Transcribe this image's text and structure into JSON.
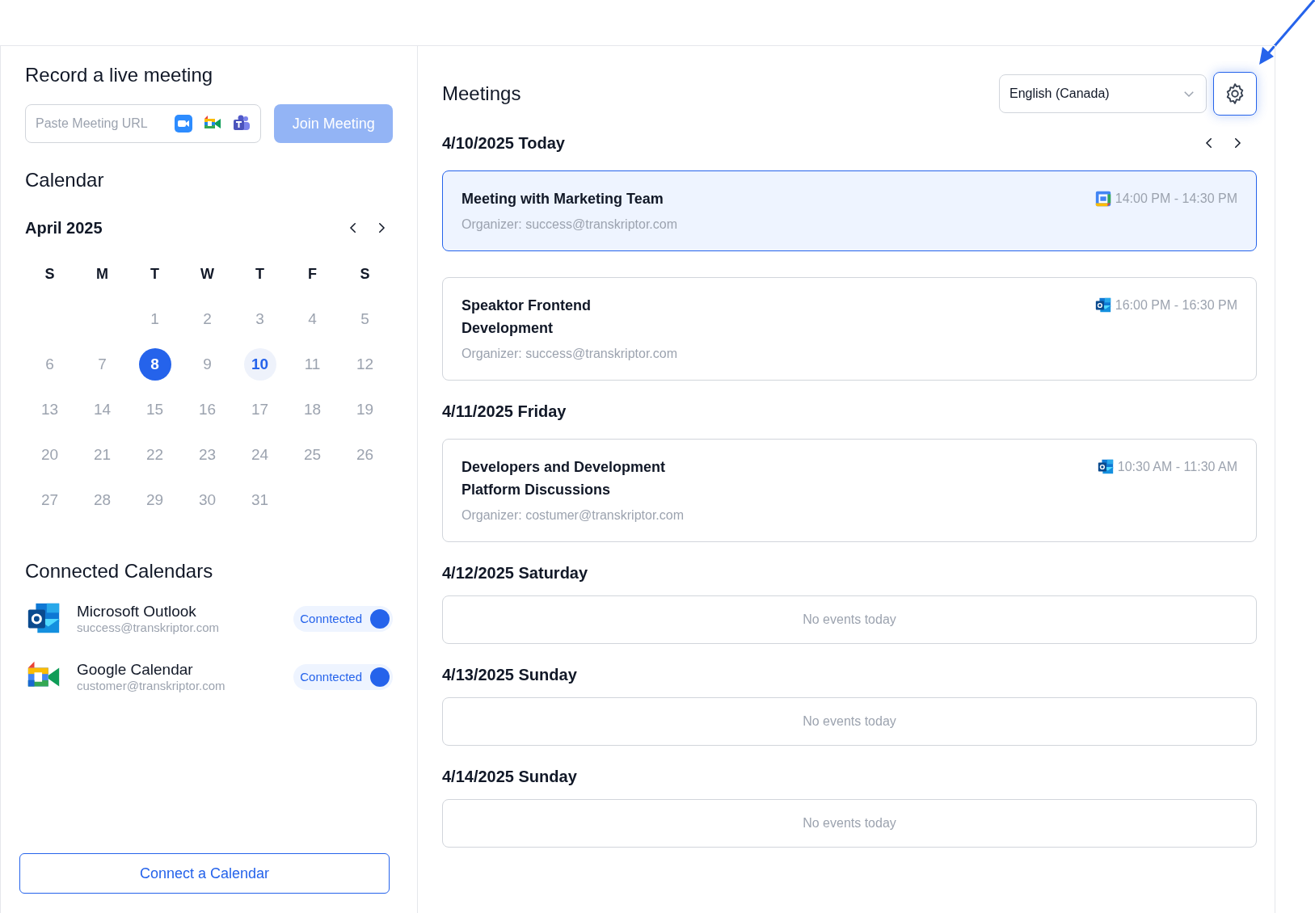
{
  "record": {
    "title": "Record a live meeting",
    "url_placeholder": "Paste Meeting URL",
    "join_button": "Join Meeting",
    "join_disabled": true
  },
  "calendar": {
    "title": "Calendar",
    "month": "April 2025",
    "weekdays": [
      "S",
      "M",
      "T",
      "W",
      "T",
      "F",
      "S"
    ],
    "days": [
      {
        "label": "1",
        "selected": false,
        "today": false
      },
      {
        "label": "2",
        "selected": false,
        "today": false
      },
      {
        "label": "3",
        "selected": false,
        "today": false
      },
      {
        "label": "4",
        "selected": false,
        "today": false
      },
      {
        "label": "5",
        "selected": false,
        "today": false
      },
      {
        "label": "6",
        "selected": false,
        "today": false
      },
      {
        "label": "7",
        "selected": false,
        "today": false
      },
      {
        "label": "8",
        "selected": true,
        "today": false
      },
      {
        "label": "9",
        "selected": false,
        "today": false
      },
      {
        "label": "10",
        "selected": false,
        "today": true
      },
      {
        "label": "11",
        "selected": false,
        "today": false
      },
      {
        "label": "12",
        "selected": false,
        "today": false
      },
      {
        "label": "13",
        "selected": false,
        "today": false
      },
      {
        "label": "14",
        "selected": false,
        "today": false
      },
      {
        "label": "15",
        "selected": false,
        "today": false
      },
      {
        "label": "16",
        "selected": false,
        "today": false
      },
      {
        "label": "17",
        "selected": false,
        "today": false
      },
      {
        "label": "18",
        "selected": false,
        "today": false
      },
      {
        "label": "19",
        "selected": false,
        "today": false
      },
      {
        "label": "20",
        "selected": false,
        "today": false
      },
      {
        "label": "21",
        "selected": false,
        "today": false
      },
      {
        "label": "22",
        "selected": false,
        "today": false
      },
      {
        "label": "23",
        "selected": false,
        "today": false
      },
      {
        "label": "24",
        "selected": false,
        "today": false
      },
      {
        "label": "25",
        "selected": false,
        "today": false
      },
      {
        "label": "26",
        "selected": false,
        "today": false
      },
      {
        "label": "27",
        "selected": false,
        "today": false
      },
      {
        "label": "28",
        "selected": false,
        "today": false
      },
      {
        "label": "29",
        "selected": false,
        "today": false
      },
      {
        "label": "30",
        "selected": false,
        "today": false
      },
      {
        "label": "31",
        "selected": false,
        "today": false
      }
    ]
  },
  "connected_calendars": {
    "title": "Connected Calendars",
    "items": [
      {
        "kind": "outlook",
        "name": "Microsoft Outlook",
        "email": "success@transkriptor.com",
        "status": "Conntected",
        "on": true
      },
      {
        "kind": "google",
        "name": "Google Calendar",
        "email": "customer@transkriptor.com",
        "status": "Conntected",
        "on": true
      }
    ],
    "connect_button": "Connect a Calendar"
  },
  "meetings": {
    "title": "Meetings",
    "language": "English (Canada)",
    "days": [
      {
        "date": "4/10/2025 Today",
        "events": [
          {
            "title": "Meeting with Marketing Team",
            "organizer": "Organizer: success@transkriptor.com",
            "time": "14:00 PM - 14:30 PM",
            "kind": "google",
            "selected": true
          },
          {
            "title": "Speaktor Frontend Development",
            "organizer": "Organizer: success@transkriptor.com",
            "time": "16:00 PM - 16:30 PM",
            "kind": "outlook",
            "selected": false
          }
        ]
      },
      {
        "date": "4/11/2025 Friday",
        "events": [
          {
            "title": "Developers and Development Platform Discussions",
            "organizer": "Organizer: costumer@transkriptor.com",
            "time": "10:30 AM - 11:30 AM",
            "kind": "outlook",
            "selected": false
          }
        ]
      },
      {
        "date": "4/12/2025 Saturday",
        "empty": "No events today"
      },
      {
        "date": "4/13/2025 Sunday",
        "empty": "No events today"
      },
      {
        "date": "4/14/2025 Sunday",
        "empty": "No events today"
      }
    ]
  }
}
